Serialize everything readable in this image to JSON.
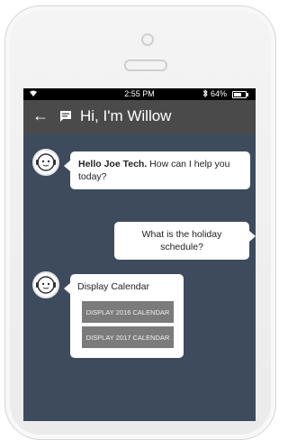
{
  "status_bar": {
    "time": "2:55 PM",
    "battery_percent_label": "64%",
    "battery_level": 0.64,
    "wifi_icon": "wifi-icon",
    "bluetooth_icon": "bluetooth-icon"
  },
  "header": {
    "back_icon": "back-arrow-icon",
    "chat_icon": "chat-icon",
    "title": "Hi, I'm Willow"
  },
  "messages": [
    {
      "from": "bot",
      "bold_text": "Hello Joe Tech.",
      "text": " How can I help you today?"
    },
    {
      "from": "user",
      "text": "What is the holiday schedule?"
    },
    {
      "from": "bot",
      "text": "Display Calendar",
      "buttons": [
        "DISPLAY 2016 CALENDAR",
        "DISPLAY 2017 CALENDAR"
      ]
    }
  ],
  "colors": {
    "chat_background": "#3d4b5d",
    "header_background": "#4a4a4a",
    "button_background": "#7b7b7b"
  }
}
